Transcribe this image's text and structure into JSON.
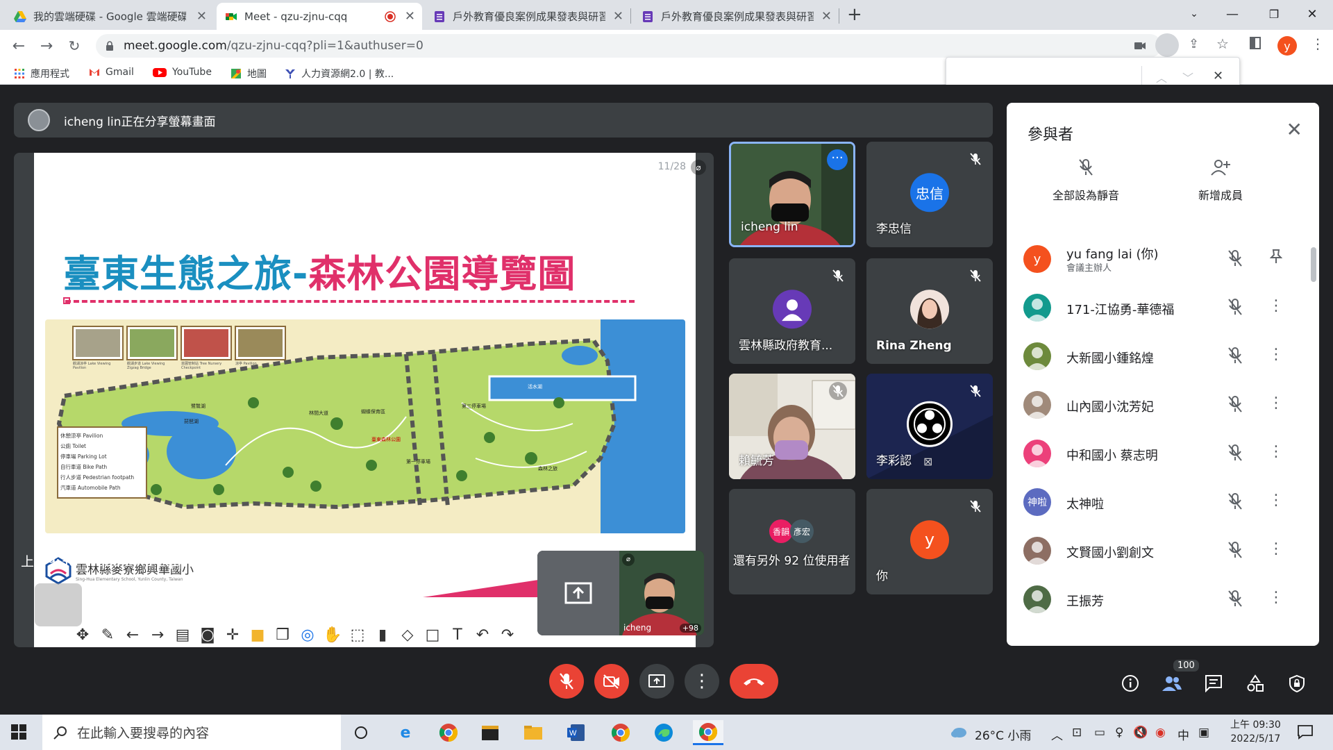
{
  "browser": {
    "tabs": [
      {
        "title": "我的雲端硬碟 - Google 雲端硬碟",
        "icon": "google-drive-icon",
        "active": false
      },
      {
        "title": "Meet - qzu-zjnu-cqq",
        "icon": "google-meet-icon",
        "active": true
      },
      {
        "title": "戶外教育優良案例成果發表與研習",
        "icon": "google-forms-icon",
        "active": false
      },
      {
        "title": "戶外教育優良案例成果發表與研習",
        "icon": "google-forms-icon",
        "active": false
      }
    ],
    "url_host": "meet.google.com",
    "url_path": "/qzu-zjnu-cqq?pli=1&authuser=0",
    "profile_initial": "y",
    "bookmarks": [
      "應用程式",
      "Gmail",
      "YouTube",
      "地圖",
      "人力資源網2.0 | 教..."
    ]
  },
  "meet": {
    "share_banner": "icheng lin正在分享螢幕畫面",
    "slide": {
      "page": "11/28",
      "title_part1": "臺東生態之旅-",
      "title_part2": "森林公園導覽圖",
      "school_name": "雲林縣麥寮鄉興華國小",
      "school_name_en": "Sing-Hua Elementary School, Yunlin County, Taiwan",
      "map_labels": [
        "活水湖",
        "琵琶湖",
        "鷺鷥湖",
        "第一停車場",
        "第三停車場",
        "林間大道",
        "蝴蝶保育區",
        "森林之旅",
        "臺東森林公園"
      ],
      "legend": [
        "休憩涼亭 Pavilion",
        "公廁 Toilet",
        "停車場 Parking Lot",
        "自行車道 Bike Path",
        "行人步道 Pedestrian footpath",
        "汽車道 Automobile Path"
      ],
      "photo_captions": [
        "觀湖涼亭 Lake Viewing Pavilion",
        "觀湖步道 Lake Viewing Zigzag Bridge",
        "苗圃管制站 Tree Nursery Checkpoint",
        "涼亭 Pavilion"
      ],
      "presenter_name": "icheng",
      "presenter_more": "+98",
      "watermark": "icheng lin"
    },
    "tiles": [
      {
        "name": "icheng lin",
        "type": "video-man",
        "speaking": true
      },
      {
        "name": "李忠信",
        "type": "avatar",
        "initials": "忠信",
        "color": "#1a73e8"
      },
      {
        "name": "雲林縣政府教育...",
        "type": "avatar",
        "initials": "",
        "color": "#673ab7"
      },
      {
        "name": "Rina Zheng",
        "type": "photo"
      },
      {
        "name": "賴毓芳",
        "type": "video-woman"
      },
      {
        "name": "李彩認",
        "type": "obs"
      },
      {
        "name": "還有另外 92 位使用者",
        "type": "more",
        "chips": [
          "香韻",
          "彥宏"
        ]
      },
      {
        "name": "你",
        "type": "avatar",
        "initials": "y",
        "color": "#f4511e"
      }
    ],
    "participants_panel": {
      "title": "參與者",
      "actions": [
        "全部設為靜音",
        "新增成員"
      ],
      "people": [
        {
          "name": "yu fang lai (你)",
          "sub": "會議主辦人",
          "avatar_text": "y",
          "color": "#f4511e"
        },
        {
          "name": "171-江協勇-華德福",
          "sub": "",
          "avatar_text": "",
          "color": "#129a8d"
        },
        {
          "name": "大新國小鍾銘煌",
          "sub": "",
          "avatar_text": "",
          "color": "#6d8a3c"
        },
        {
          "name": "山內國小沈芳妃",
          "sub": "",
          "avatar_text": "",
          "color": "#a08a7a"
        },
        {
          "name": "中和國小 蔡志明",
          "sub": "",
          "avatar_text": "",
          "color": "#ec407a"
        },
        {
          "name": "太神啦",
          "sub": "",
          "avatar_text": "神啦",
          "color": "#5c6bc0"
        },
        {
          "name": "文賢國小劉創文",
          "sub": "",
          "avatar_text": "",
          "color": "#8d6e63"
        },
        {
          "name": "王振芳",
          "sub": "",
          "avatar_text": "",
          "color": "#4e6b45"
        }
      ]
    },
    "bottom": {
      "time": "上午9:30",
      "code": "qzu-zjnu-cqq",
      "participant_count": "100"
    }
  },
  "taskbar": {
    "search_placeholder": "在此輸入要搜尋的內容",
    "weather": "26°C 小雨",
    "ime": "中",
    "time": "上午 09:30",
    "date": "2022/5/17"
  }
}
